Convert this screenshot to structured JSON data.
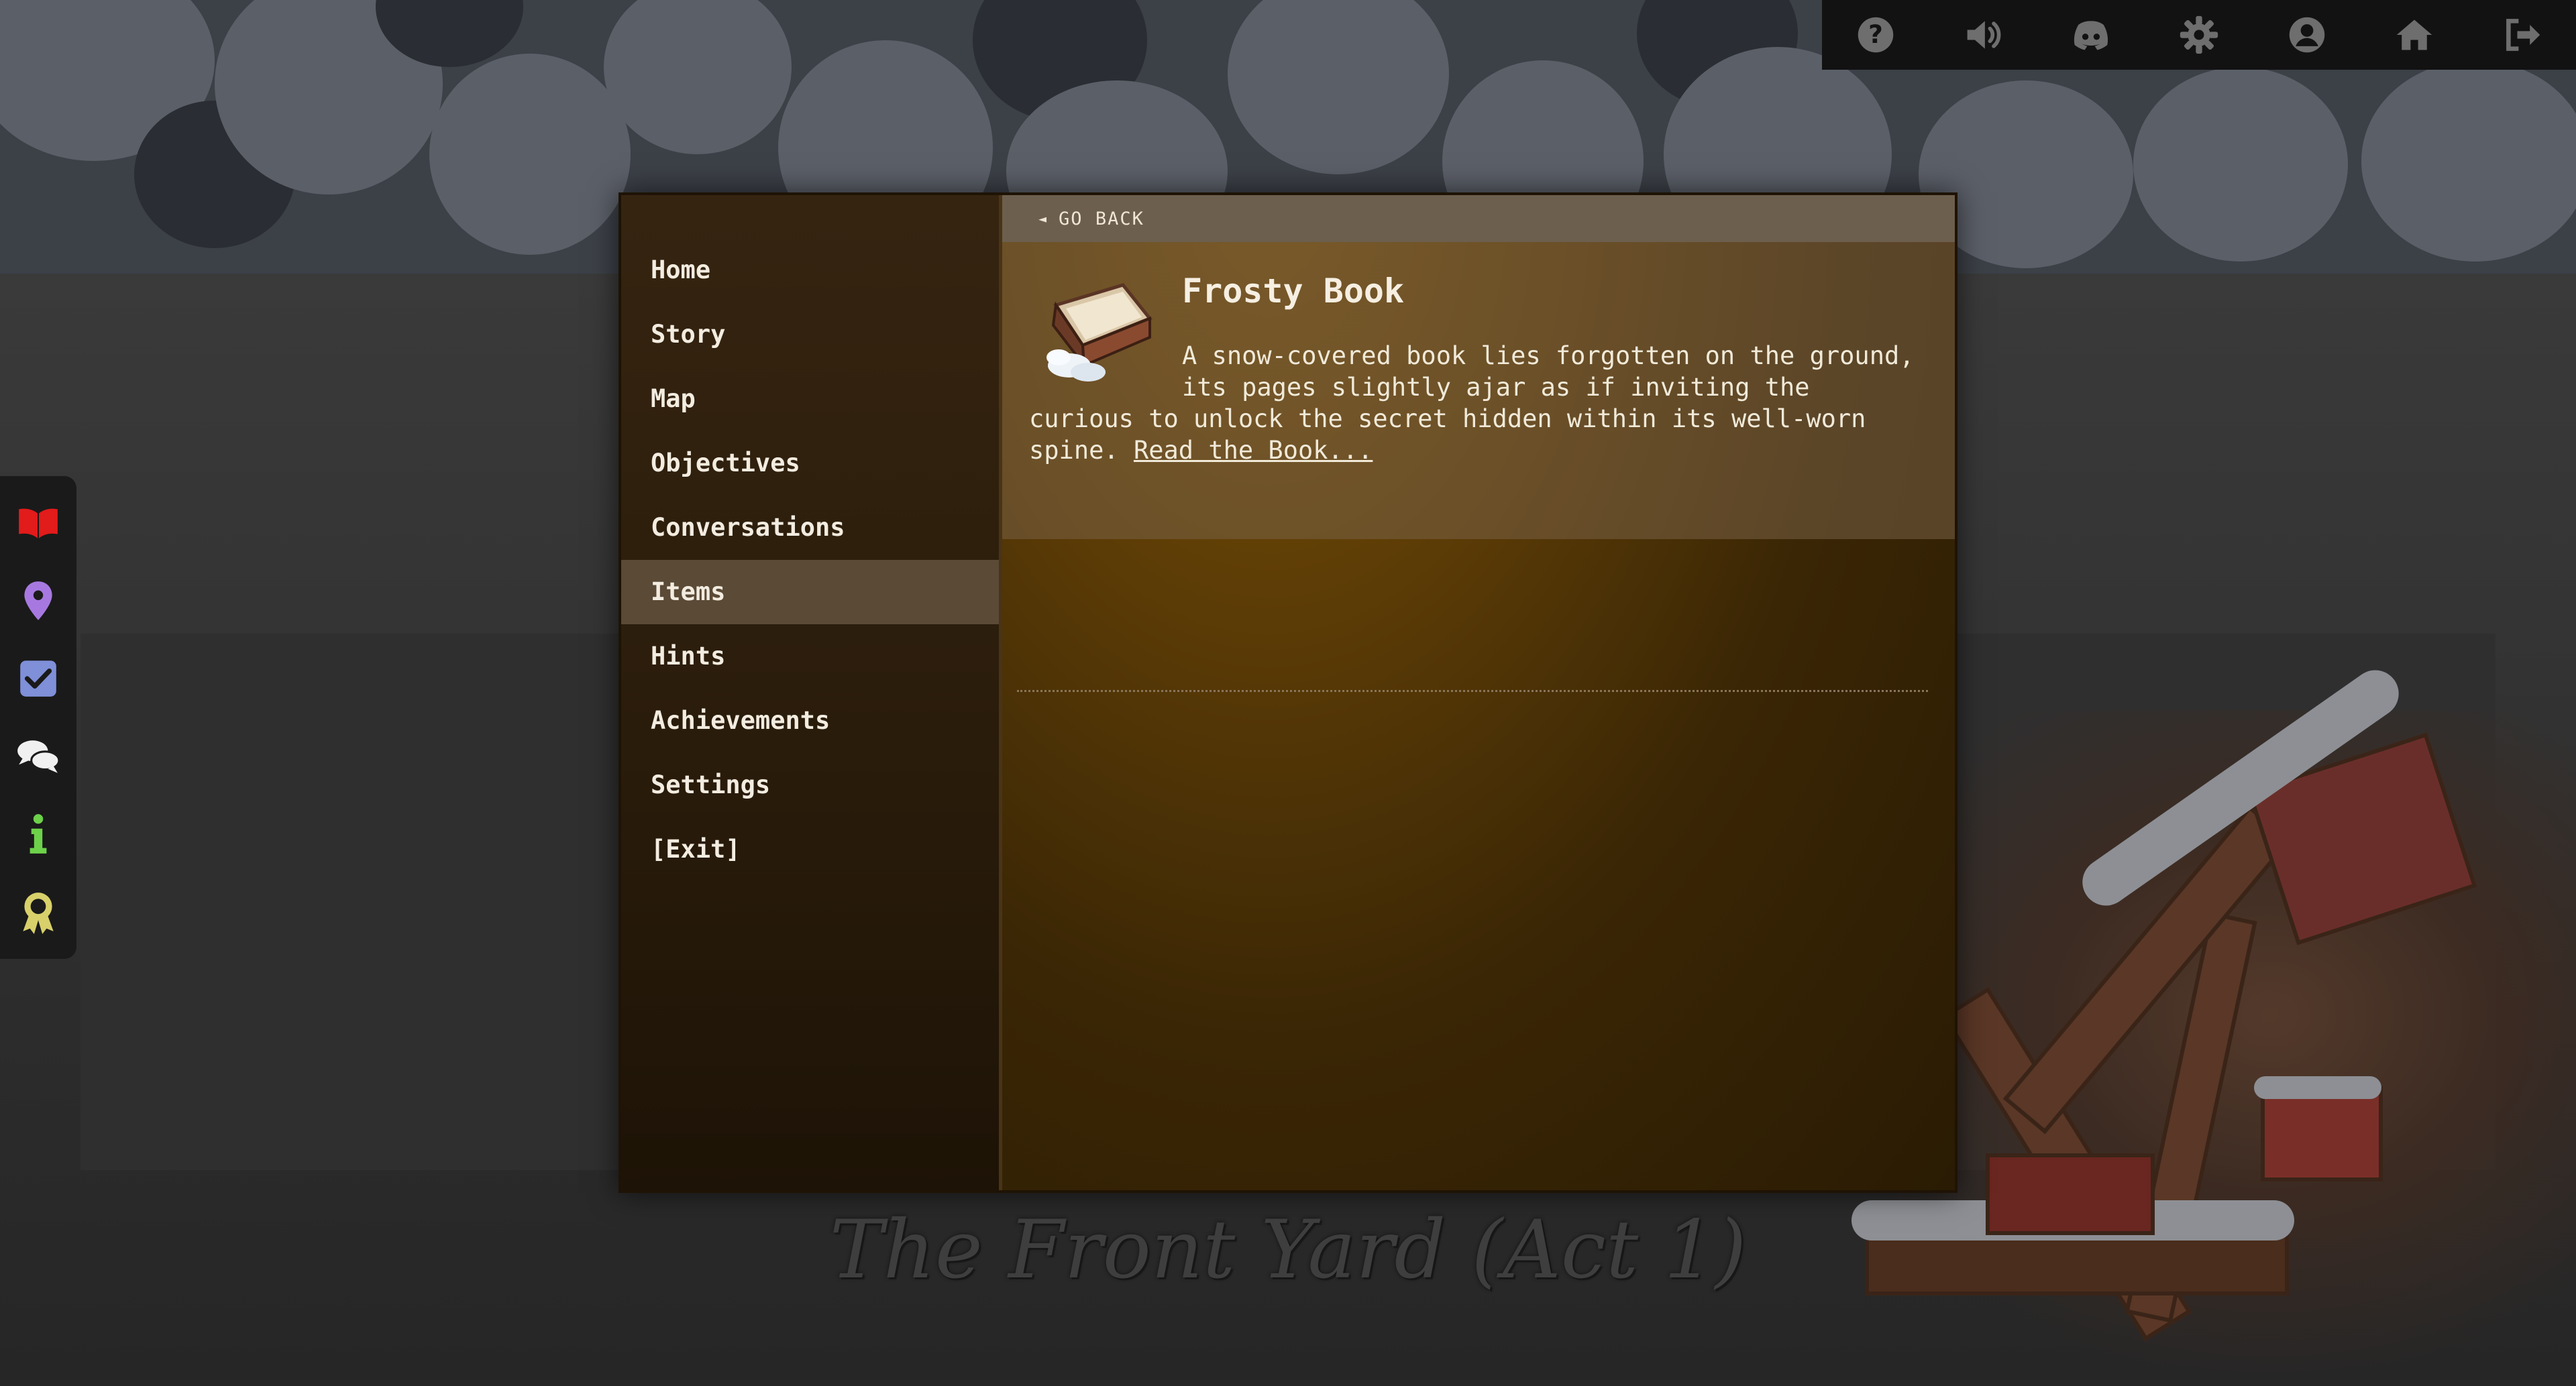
{
  "top_toolbar": {
    "icons": [
      "help-icon",
      "volume-icon",
      "discord-icon",
      "settings-gear-icon",
      "profile-icon",
      "home-icon",
      "logout-icon"
    ]
  },
  "side_toolbar": {
    "icons": [
      {
        "name": "journal-book-icon",
        "color": "#e21b1b"
      },
      {
        "name": "map-pin-icon",
        "color": "#a779e0"
      },
      {
        "name": "objectives-check-icon",
        "color": "#7f8fd8"
      },
      {
        "name": "conversations-chat-icon",
        "color": "#f0f0f0"
      },
      {
        "name": "hints-info-icon",
        "color": "#6dd14a"
      },
      {
        "name": "achievements-ribbon-icon",
        "color": "#d8d06a"
      }
    ]
  },
  "journal": {
    "nav": [
      {
        "label": "Home"
      },
      {
        "label": "Story"
      },
      {
        "label": "Map"
      },
      {
        "label": "Objectives"
      },
      {
        "label": "Conversations"
      },
      {
        "label": "Items",
        "active": true
      },
      {
        "label": "Hints"
      },
      {
        "label": "Achievements"
      },
      {
        "label": "Settings"
      },
      {
        "label": "[Exit]"
      }
    ],
    "go_back_label": "GO BACK",
    "item": {
      "title": "Frosty Book",
      "description_line1": "A snow-covered book lies forgotten on the ground,",
      "description_rest": "its pages slightly ajar as if inviting the curious to unlock the secret hidden within its well-worn spine.",
      "link_label": "Read the Book..."
    }
  },
  "scene": {
    "location_title": "The Front Yard (Act 1)"
  },
  "colors": {
    "panel_dark": "#1e1305",
    "nav_active": "#5a4a36",
    "go_back_bar": "#6d5f4e",
    "content_glow": "#7a5207"
  }
}
